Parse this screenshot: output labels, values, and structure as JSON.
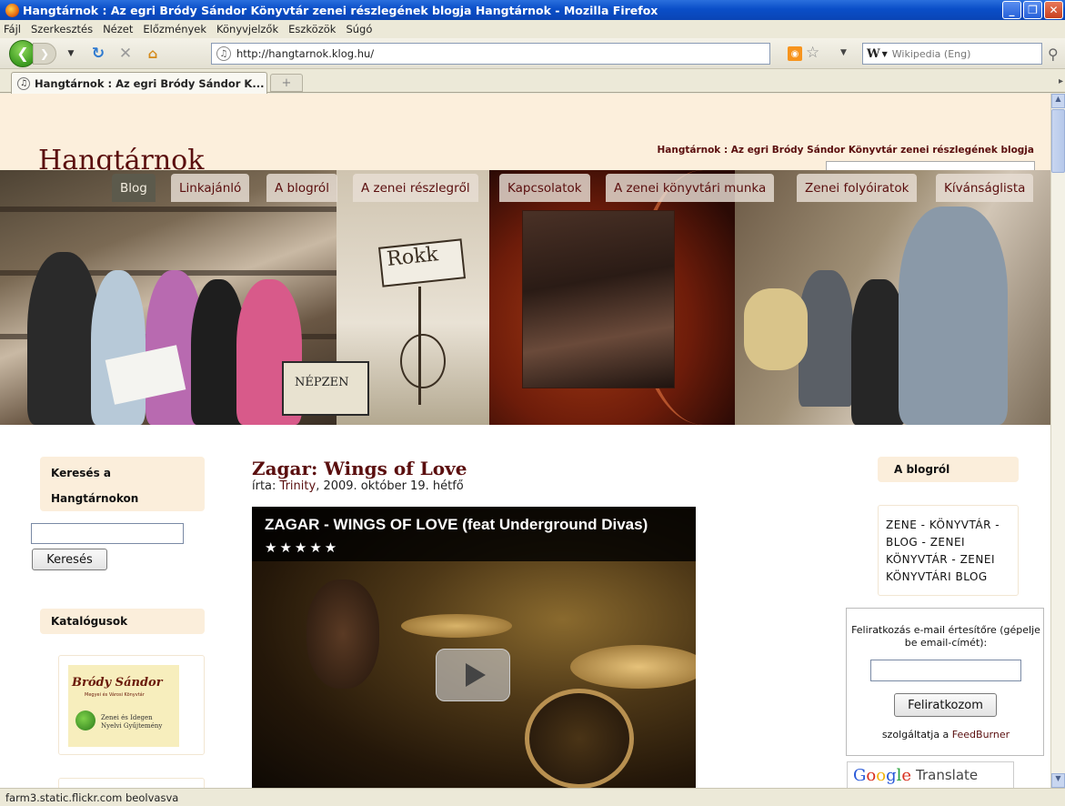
{
  "browser": {
    "window_title": "Hangtárnok : Az egri Bródy Sándor Könyvtár zenei részlegének blogja Hangtárnok - Mozilla Firefox",
    "menu": [
      "Fájl",
      "Szerkesztés",
      "Nézet",
      "Előzmények",
      "Könyvjelzők",
      "Eszközök",
      "Súgó"
    ],
    "url": "http://hangtarnok.klog.hu/",
    "search_placeholder": "Wikipedia (Eng)",
    "search_engine_icon": "W",
    "tab_title": "Hangtárnok : Az egri Bródy Sándor K...",
    "status_text": "farm3.static.flickr.com beolvasva"
  },
  "site": {
    "title": "Hangtárnok",
    "tagline": "Hangtárnok : Az egri Bródy Sándor Könyvtár zenei részlegének blogja",
    "nav": [
      {
        "label": "Blog",
        "active": true
      },
      {
        "label": "Linkajánló",
        "active": false
      },
      {
        "label": "A blogról",
        "active": false
      },
      {
        "label": "A zenei részlegről",
        "active": false
      },
      {
        "label": "Kapcsolatok",
        "active": false
      },
      {
        "label": "A zenei könyvtári munka",
        "active": false
      },
      {
        "label": "Zenei folyóiratok",
        "active": false
      },
      {
        "label": "Kívánságlista",
        "active": false
      }
    ],
    "banner_sign_text": "Rokk",
    "banner_sign2_text": "NÉPZEN"
  },
  "left_sidebar": {
    "search_title_line1": "Keresés a",
    "search_title_line2": "Hangtárnokon",
    "search_button": "Keresés",
    "catalogs_title": "Katalógusok",
    "catalog_logo_name": "Bródy Sándor",
    "catalog_logo_sub": "Megyei és Városi Könyvtár",
    "catalog_logo_line1": "Zenei és Idegen",
    "catalog_logo_line2": "Nyelvi Gyűjtemény"
  },
  "post": {
    "title": "Zagar: Wings of Love",
    "meta_prefix": "írta: ",
    "author": "Trinity",
    "meta_suffix": ", 2009. október 19. hétfő",
    "video_title": "ZAGAR - WINGS OF LOVE (feat Underground Divas)",
    "video_rating_stars": "★★★★★",
    "video_rating": 5
  },
  "right_sidebar": {
    "about_title": "A blogról",
    "about_text": "ZENE - KÖNYVTÁR - BLOG - ZENEI KÖNYVTÁR - ZENEI KÖNYVTÁRI BLOG",
    "subscribe_text": "Feliratkozás e-mail értesítőre (gépelje be email-címét):",
    "subscribe_button": "Feliratkozom",
    "powered_prefix": "szolgáltatja a ",
    "powered_link": "FeedBurner",
    "translate_logo": "Google",
    "translate_label": "Translate"
  },
  "colors": {
    "brand": "#5a0e0e",
    "header_bg": "#fcefdc",
    "active_tab_bg": "#5c5a4c",
    "xp_titlebar": "#0a4ec8"
  }
}
